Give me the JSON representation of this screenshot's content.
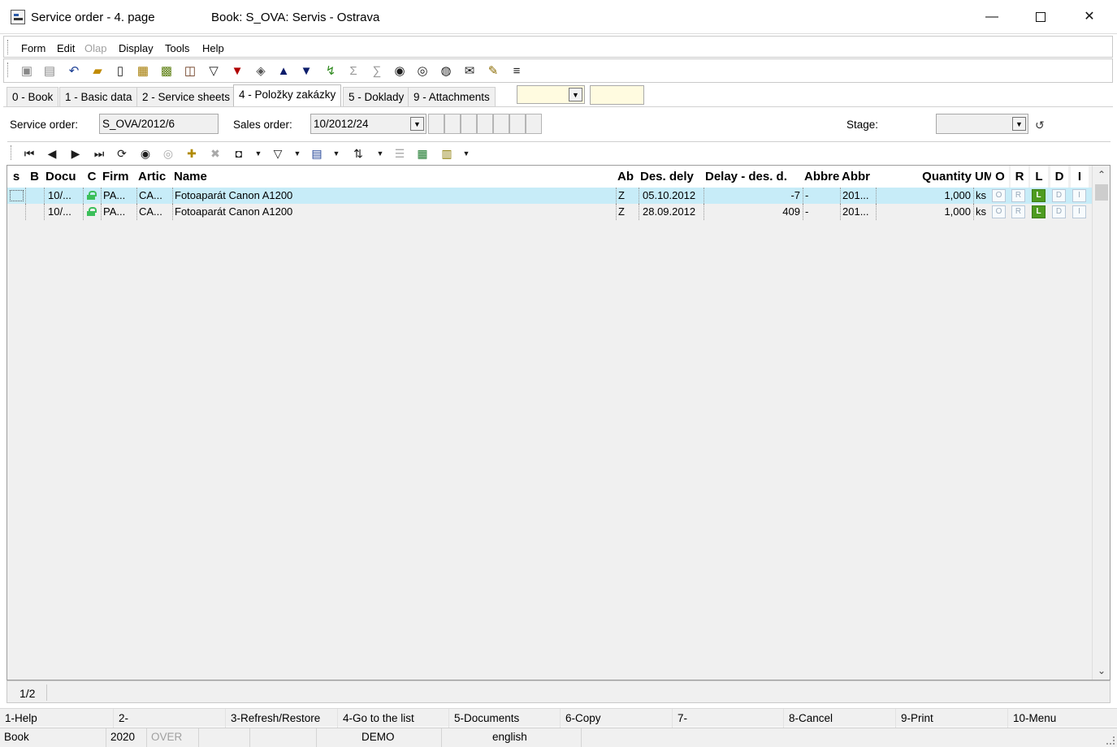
{
  "window": {
    "title": "Service order - 4. page",
    "book": "Book: S_OVA: Servis - Ostrava",
    "minimize": "—",
    "close": "✕"
  },
  "menu": [
    "Form",
    "Edit",
    "Olap",
    "Display",
    "Tools",
    "Help"
  ],
  "toolbar_icons": [
    "save-icon",
    "save-as-icon",
    "undo-icon",
    "open-folder-icon",
    "new-document-icon",
    "copy-records-icon",
    "lock-record-icon",
    "book-icon",
    "filter-icon",
    "filter-settings-icon",
    "layers-icon",
    "move-up-icon",
    "move-down-icon",
    "import-icon",
    "sum-icon",
    "sum-filter-icon",
    "find-icon",
    "find-next-icon",
    "find-replace-icon",
    "email-icon",
    "notes-icon",
    "more-menu-icon"
  ],
  "tabs": [
    {
      "label": "0 - Book"
    },
    {
      "label": "1 - Basic data"
    },
    {
      "label": "2 - Service sheets"
    },
    {
      "label": "4 - Položky zakázky",
      "active": true
    },
    {
      "label": "5 - Doklady"
    },
    {
      "label": "9 - Attachments"
    }
  ],
  "header": {
    "service_order_label": "Service order:",
    "service_order_value": "S_OVA/2012/6",
    "sales_order_label": "Sales order:",
    "sales_order_value": "10/2012/24",
    "stage_label": "Stage:",
    "stage_value": ""
  },
  "grid": {
    "columns": [
      "s",
      "B",
      "Docu",
      "C",
      "Firm",
      "Artic",
      "Name",
      "Ab",
      "Des. dely",
      "Delay - des. d.",
      "Abbre",
      "Abbr",
      "Quantity",
      "UM",
      "O",
      "R",
      "L",
      "D",
      "I"
    ],
    "rows": [
      {
        "document": "10/...",
        "firm": "PA...",
        "article": "CA...",
        "name": "Fotoaparát Canon A1200",
        "ab": "Z",
        "des_delivery": "05.10.2012",
        "delay": "-7",
        "abbre": "-",
        "abbr": "201...",
        "quantity": "1,000",
        "um": "ks",
        "flags": [
          "O",
          "R",
          "L",
          "D",
          "I"
        ],
        "active_flag": "L",
        "selected": true
      },
      {
        "document": "10/...",
        "firm": "PA...",
        "article": "CA...",
        "name": "Fotoaparát Canon A1200",
        "ab": "Z",
        "des_delivery": "28.09.2012",
        "delay": "409",
        "abbre": "-",
        "abbr": "201...",
        "quantity": "1,000",
        "um": "ks",
        "flags": [
          "O",
          "R",
          "L",
          "D",
          "I"
        ],
        "active_flag": "L",
        "selected": false
      }
    ]
  },
  "record_count": "1/2",
  "function_keys": [
    "1-Help",
    "2-",
    "3-Refresh/Restore",
    "4-Go to the list",
    "5-Documents",
    "6-Copy",
    "7-",
    "8-Cancel",
    "9-Print",
    "10-Menu"
  ],
  "status": {
    "mode": "Book",
    "year": "2020",
    "overwrite": "OVER",
    "database": "DEMO",
    "language": "english"
  },
  "colors": {
    "selected_row": "#c7ecf8",
    "flag_active": "#4d9b1f",
    "field_highlight": "#fffbe0",
    "lock": "#3bbf5a"
  }
}
